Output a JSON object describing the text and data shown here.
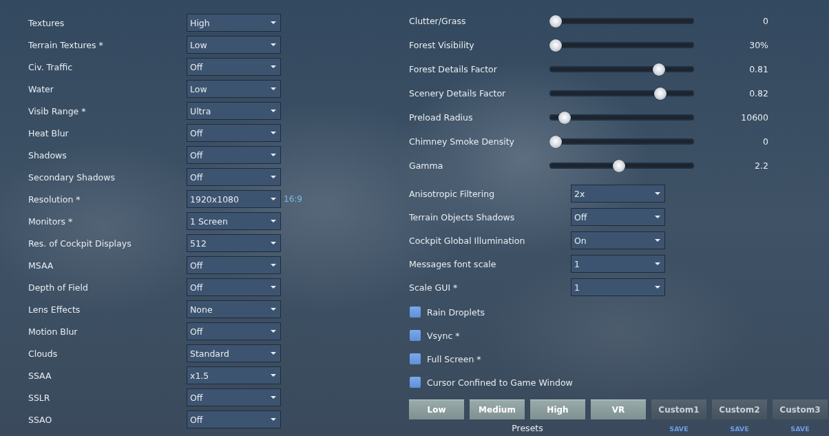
{
  "graphics_settings": [
    {
      "label": "Textures",
      "value": "High"
    },
    {
      "label": "Terrain Textures *",
      "value": "Low"
    },
    {
      "label": "Civ. Traffic",
      "value": "Off"
    },
    {
      "label": "Water",
      "value": "Low"
    },
    {
      "label": "Visib Range *",
      "value": "Ultra"
    },
    {
      "label": "Heat Blur",
      "value": "Off"
    },
    {
      "label": "Shadows",
      "value": "Off"
    },
    {
      "label": "Secondary Shadows",
      "value": "Off"
    },
    {
      "label": "Resolution *",
      "value": "1920x1080",
      "aspect": "16:9"
    },
    {
      "label": "Monitors *",
      "value": "1 Screen"
    },
    {
      "label": "Res. of Cockpit Displays",
      "value": "512"
    },
    {
      "label": "MSAA",
      "value": "Off"
    },
    {
      "label": "Depth of Field",
      "value": "Off"
    },
    {
      "label": "Lens Effects",
      "value": "None"
    },
    {
      "label": "Motion Blur",
      "value": "Off"
    },
    {
      "label": "Clouds",
      "value": "Standard"
    },
    {
      "label": "SSAA",
      "value": "x1.5"
    },
    {
      "label": "SSLR",
      "value": "Off"
    },
    {
      "label": "SSAO",
      "value": "Off"
    }
  ],
  "sliders": [
    {
      "label": "Clutter/Grass",
      "level": 0,
      "reading": "0"
    },
    {
      "label": "Forest Visibility",
      "level": 0,
      "reading": "30%"
    },
    {
      "label": "Forest Details Factor",
      "level": 0.78,
      "reading": "0.81"
    },
    {
      "label": "Scenery Details Factor",
      "level": 0.79,
      "reading": "0.82"
    },
    {
      "label": "Preload Radius",
      "level": 0.07,
      "reading": "10600"
    },
    {
      "label": "Chimney Smoke Density",
      "level": 0,
      "reading": "0"
    },
    {
      "label": "Gamma",
      "level": 0.48,
      "reading": "2.2"
    }
  ],
  "extra_settings": [
    {
      "label": "Anisotropic Filtering",
      "value": "2x"
    },
    {
      "label": "Terrain Objects Shadows",
      "value": "Off"
    },
    {
      "label": "Cockpit Global Illumination",
      "value": "On"
    },
    {
      "label": "Messages font scale",
      "value": "1"
    },
    {
      "label": "Scale GUI *",
      "value": "1"
    }
  ],
  "checkboxes": [
    {
      "label": "Rain Droplets",
      "checked": false
    },
    {
      "label": "Vsync *",
      "checked": false
    },
    {
      "label": "Full Screen *",
      "checked": false
    },
    {
      "label": "Cursor Confined to Game Window",
      "checked": false
    }
  ],
  "presets": {
    "caption": "Presets",
    "buttons": [
      {
        "label": "Low",
        "kind": "builtin"
      },
      {
        "label": "Medium",
        "kind": "builtin"
      },
      {
        "label": "High",
        "kind": "builtin"
      },
      {
        "label": "VR",
        "kind": "builtin"
      },
      {
        "label": "Custom1",
        "kind": "custom",
        "save": "SAVE"
      },
      {
        "label": "Custom2",
        "kind": "custom",
        "save": "SAVE"
      },
      {
        "label": "Custom3",
        "kind": "custom",
        "save": "SAVE"
      }
    ]
  }
}
